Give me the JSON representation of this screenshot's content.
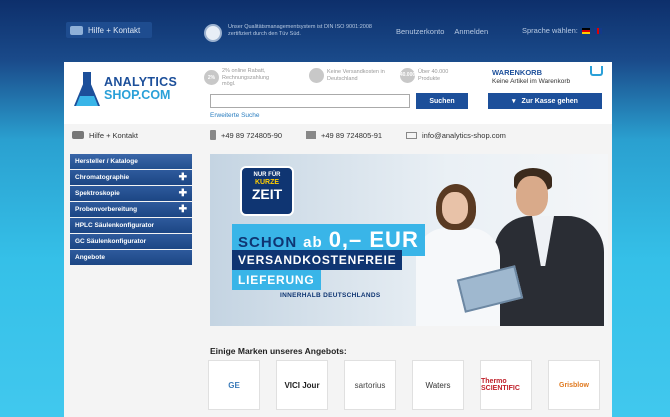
{
  "topbar": {
    "help_label": "Hilfe + Kontakt",
    "certification_text": "Unser Qualitätsmanagementsystem ist DIN ISO 9001:2008 zertifiziert durch den Tüv Süd.",
    "account_link": "Benutzerkonto",
    "login_link": "Anmelden",
    "language_label": "Sprache wählen:"
  },
  "header": {
    "logo": {
      "line1": "ANALYTICS",
      "line2": "SHOP.COM"
    },
    "usps": [
      {
        "badge": "2%",
        "text": "2% online Rabatt, Rechnungszahlung mögl."
      },
      {
        "badge": "",
        "text": "Keine Versandkosten in Deutschland"
      },
      {
        "badge": "40.000",
        "text": "Über 40.000 Produkte"
      }
    ],
    "search": {
      "placeholder": "",
      "button_label": "Suchen",
      "advanced_link": "Erweiterte Suche"
    },
    "cart": {
      "title": "WARENKORB",
      "status": "Keine Artikel im Warenkorb",
      "checkout_label": "Zur Kasse gehen"
    }
  },
  "contact": {
    "help_label": "Hilfe + Kontakt",
    "phone": "+49 89 724805-90",
    "fax": "+49 89 724805-91",
    "email": "info@analytics-shop.com"
  },
  "sidebar": {
    "items": [
      {
        "label": "Hersteller / Kataloge",
        "expandable": false
      },
      {
        "label": "Chromatographie",
        "expandable": true
      },
      {
        "label": "Spektroskopie",
        "expandable": true
      },
      {
        "label": "Probenvorbereitung",
        "expandable": true
      },
      {
        "label": "HPLC Säulenkonfigurator",
        "expandable": false
      },
      {
        "label": "GC Säulenkonfigurator",
        "expandable": false
      },
      {
        "label": "Angebote",
        "expandable": false
      }
    ]
  },
  "banner": {
    "badge_line1": "NUR FÜR",
    "badge_line2": "KURZE",
    "badge_line3": "ZEIT",
    "line1_prefix": "SCHON",
    "line1_ab": "ab",
    "line1_price": "0,– EUR",
    "line2": "VERSANDKOSTENFREIE",
    "line3": "LIEFERUNG",
    "line4": "INNERHALB DEUTSCHLANDS"
  },
  "brands": {
    "title": "Einige Marken unseres Angebots:",
    "items": [
      "GE",
      "VICI Jour",
      "sartorius",
      "Waters",
      "Thermo SCIENTIFIC",
      "Grisblow"
    ]
  },
  "colors": {
    "brand_dark": "#1c4f9a",
    "brand_light": "#39b5e8",
    "navy": "#0f3572"
  }
}
